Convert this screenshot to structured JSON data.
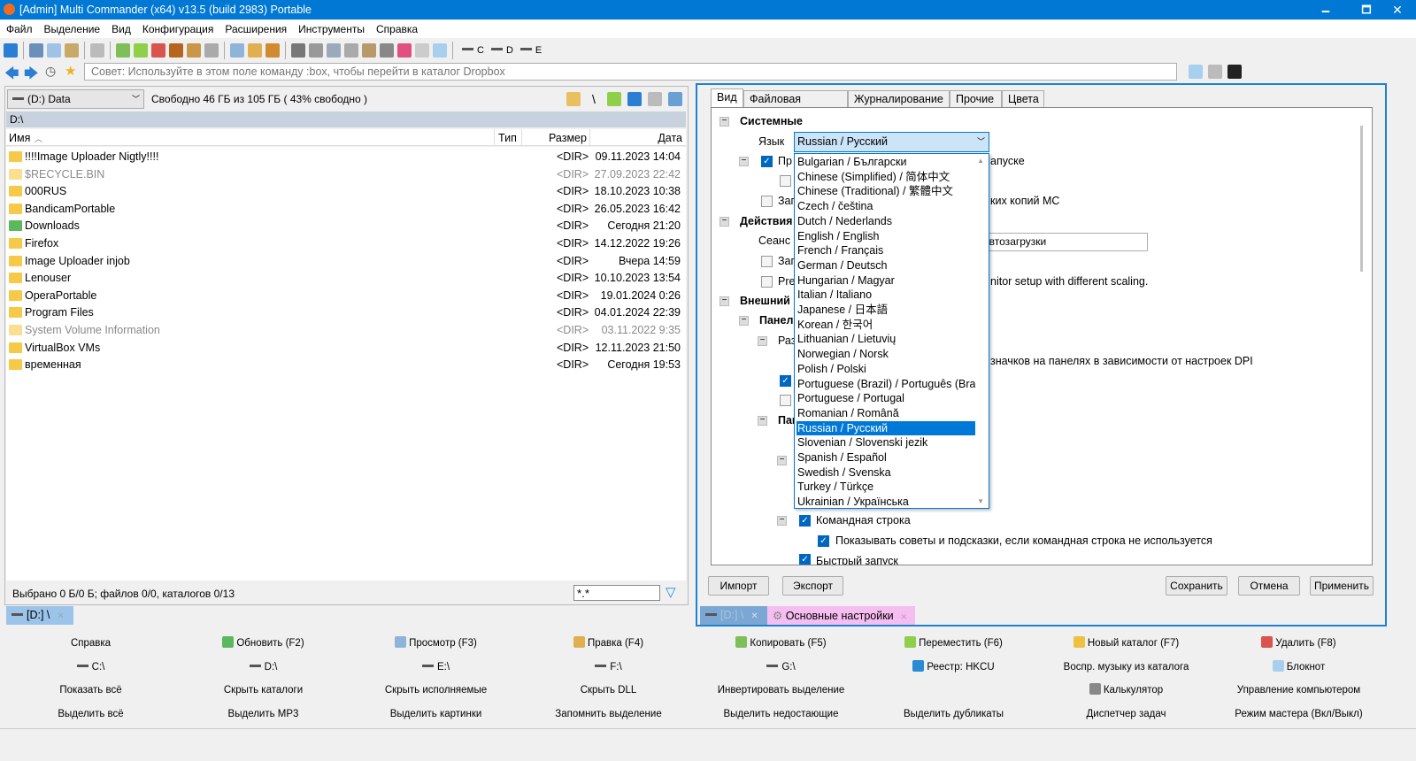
{
  "window": {
    "title": "[Admin] Multi Commander (x64)  v13.5 (build 2983) Portable",
    "minimize": "🗕",
    "maximize": "🗖",
    "close": "✕"
  },
  "menu": [
    "Файл",
    "Выделение",
    "Вид",
    "Конфигурация",
    "Расширения",
    "Инструменты",
    "Справка"
  ],
  "toolbar": {
    "icons": [
      {
        "name": "refresh-icon",
        "color": "#2a7fd4"
      },
      {
        "sep": true
      },
      {
        "name": "cut-icon",
        "color": "#6a8fb8"
      },
      {
        "name": "copy-icon",
        "color": "#9fc3e6"
      },
      {
        "name": "paste-icon",
        "color": "#c8a96a"
      },
      {
        "sep": true
      },
      {
        "name": "select-icon",
        "color": "#bbbbbb"
      },
      {
        "sep": true
      },
      {
        "name": "new-file-icon",
        "color": "#7fbf5a"
      },
      {
        "name": "move-file-icon",
        "color": "#8fcf4a"
      },
      {
        "name": "delete-file-icon",
        "color": "#d9534f"
      },
      {
        "name": "archive-icon",
        "color": "#b5651d"
      },
      {
        "name": "package-icon",
        "color": "#c9964a"
      },
      {
        "name": "new-folder-icon",
        "color": "#aaaaaa"
      },
      {
        "sep": true
      },
      {
        "name": "view-icon",
        "color": "#8fb4d9"
      },
      {
        "name": "edit-icon",
        "color": "#e0b050"
      },
      {
        "name": "find-icon",
        "color": "#d08b30"
      },
      {
        "sep": true
      },
      {
        "name": "size-icon",
        "color": "#777777"
      },
      {
        "name": "doc-icon",
        "color": "#999999"
      },
      {
        "name": "doc2-icon",
        "color": "#9aaabb"
      },
      {
        "name": "doc3-icon",
        "color": "#aaaaaa"
      },
      {
        "name": "clipboard-icon",
        "color": "#b89a6a"
      },
      {
        "name": "eye-icon",
        "color": "#888888"
      },
      {
        "name": "color-wheel-icon",
        "color": "#e05080"
      },
      {
        "name": "chat-icon",
        "color": "#cccccc"
      },
      {
        "name": "screen-icon",
        "color": "#a8cfee"
      },
      {
        "sep": true
      }
    ],
    "drives": [
      "C",
      "D",
      "E"
    ]
  },
  "nav": {
    "cmd_placeholder": "Совет: Используйте в этом поле команду :box, чтобы перейти в каталог Dropbox"
  },
  "left": {
    "drive": "(D:) Data",
    "free": "Свободно 46 ГБ из 105 ГБ ( 43% свободно )",
    "path": "D:\\",
    "columns": {
      "name": "Имя",
      "type": "Тип",
      "size": "Размер",
      "date": "Дата"
    },
    "files": [
      {
        "name": "!!!!Image Uploader Nigtly!!!!",
        "size": "<DIR>",
        "date": "09.11.2023 14:04"
      },
      {
        "name": "$RECYCLE.BIN",
        "size": "<DIR>",
        "date": "27.09.2023 22:42",
        "gray": true
      },
      {
        "name": "000RUS",
        "size": "<DIR>",
        "date": "18.10.2023 10:38"
      },
      {
        "name": "BandicamPortable",
        "size": "<DIR>",
        "date": "26.05.2023 16:42"
      },
      {
        "name": "Downloads",
        "size": "<DIR>",
        "date": "Сегодня 21:20"
      },
      {
        "name": "Firefox",
        "size": "<DIR>",
        "date": "14.12.2022 19:26"
      },
      {
        "name": "Image Uploader injob",
        "size": "<DIR>",
        "date": "Вчера 14:59"
      },
      {
        "name": "Lenouser",
        "size": "<DIR>",
        "date": "10.10.2023 13:54"
      },
      {
        "name": "OperaPortable",
        "size": "<DIR>",
        "date": "19.01.2024 0:26"
      },
      {
        "name": "Program Files",
        "size": "<DIR>",
        "date": "04.01.2024 22:39"
      },
      {
        "name": "System Volume Information",
        "size": "<DIR>",
        "date": "03.11.2022 9:35",
        "gray": true
      },
      {
        "name": "VirtualBox VMs",
        "size": "<DIR>",
        "date": "12.11.2023 21:50"
      },
      {
        "name": "временная",
        "size": "<DIR>",
        "date": "Сегодня 19:53"
      }
    ],
    "status": "Выбрано 0 Б/0 Б; файлов 0/0, каталогов 0/13",
    "filter": "*.*",
    "tab": "[D:] \\"
  },
  "right": {
    "tabs": [
      "Вид",
      "Файловая система",
      "Журналирование",
      "Прочие",
      "Цвета"
    ],
    "tree": {
      "system": "Системные",
      "lang_label": "Язык",
      "lang_value": "Russian / Русский",
      "frag1a": "Пр",
      "frag1b": "апуске",
      "frag2a": "Зап",
      "frag2b": "ких копий MC",
      "actions": "Действия",
      "session": "Сеанс",
      "session_value": "автозагрузки",
      "frag3": "Зап",
      "frag4a": "Pre",
      "frag4b": "nitor setup with different scaling.",
      "external": "Внешний",
      "panels": "Панел",
      "frag5": "Раз",
      "frag6": "значков на панелях в зависимости от настроек DPI",
      "frag7": "Пан",
      "cmdline": "Командная строка",
      "tips": "Показывать советы и подсказки, если командная строка не используется",
      "quick": "Быстрый запуск"
    },
    "languages": [
      "Bulgarian / Български",
      "Chinese (Simplified) / 简体中文",
      "Chinese (Traditional) / 繁體中文",
      "Czech / čeština",
      "Dutch / Nederlands",
      "English / English",
      "French / Français",
      "German / Deutsch",
      "Hungarian / Magyar",
      "Italian / Italiano",
      "Japanese / 日本語",
      "Korean / 한국어",
      "Lithuanian / Lietuvių",
      "Norwegian / Norsk",
      "Polish / Polski",
      "Portuguese (Brazil) / Português (Brasil)",
      "Portuguese / Portugal",
      "Romanian / Română",
      "Russian / Русский",
      "Slovenian / Slovenski jezik",
      "Spanish / Español",
      "Swedish / Svenska",
      "Turkey / Türkçe",
      "Ukrainian / Українська"
    ],
    "selected_language": "Russian / Русский",
    "buttons": {
      "import": "Импорт",
      "export": "Экспорт",
      "save": "Сохранить",
      "cancel": "Отмена",
      "apply": "Применить"
    },
    "tab_drive": "[D:] \\",
    "tab_settings": "Основные настройки"
  },
  "fbar": [
    {
      "label": "Справка"
    },
    {
      "label": "Обновить (F2)",
      "icon": "refresh-icon",
      "color": "#5cb85c"
    },
    {
      "label": "Просмотр (F3)",
      "icon": "view-icon",
      "color": "#8fb4d9"
    },
    {
      "label": "Правка (F4)",
      "icon": "edit-icon",
      "color": "#e0b050"
    },
    {
      "label": "Копировать (F5)",
      "icon": "copy-icon",
      "color": "#7fbf5a"
    },
    {
      "label": "Переместить (F6)",
      "icon": "move-icon",
      "color": "#8fcf4a"
    },
    {
      "label": "Новый каталог (F7)",
      "icon": "new-folder-icon",
      "color": "#f0c040"
    },
    {
      "label": "Удалить (F8)",
      "icon": "delete-icon",
      "color": "#d9534f"
    },
    {
      "label": "C:\\",
      "drive": true
    },
    {
      "label": "D:\\",
      "drive": true
    },
    {
      "label": "E:\\",
      "drive": true
    },
    {
      "label": "F:\\",
      "drive": true
    },
    {
      "label": "G:\\",
      "drive": true
    },
    {
      "label": "Реестр: HKCU",
      "icon": "registry-icon",
      "color": "#2a8ad4"
    },
    {
      "label": "Воспр. музыку из каталога"
    },
    {
      "label": "Блокнот",
      "icon": "notepad-icon",
      "color": "#a8cfee"
    },
    {
      "label": "Показать всё"
    },
    {
      "label": "Скрыть каталоги"
    },
    {
      "label": "Скрыть исполняемые"
    },
    {
      "label": "Скрыть DLL"
    },
    {
      "label": "Инвертировать выделение"
    },
    {
      "label": ""
    },
    {
      "label": "Калькулятор",
      "icon": "calculator-icon",
      "color": "#888888"
    },
    {
      "label": "Управление компьютером"
    },
    {
      "label": "Выделить всё"
    },
    {
      "label": "Выделить MP3"
    },
    {
      "label": "Выделить картинки"
    },
    {
      "label": "Запомнить выделение"
    },
    {
      "label": "Выделить недостающие"
    },
    {
      "label": "Выделить дубликаты"
    },
    {
      "label": "Диспетчер задач"
    },
    {
      "label": "Режим мастера (Вкл/Выкл)"
    }
  ]
}
